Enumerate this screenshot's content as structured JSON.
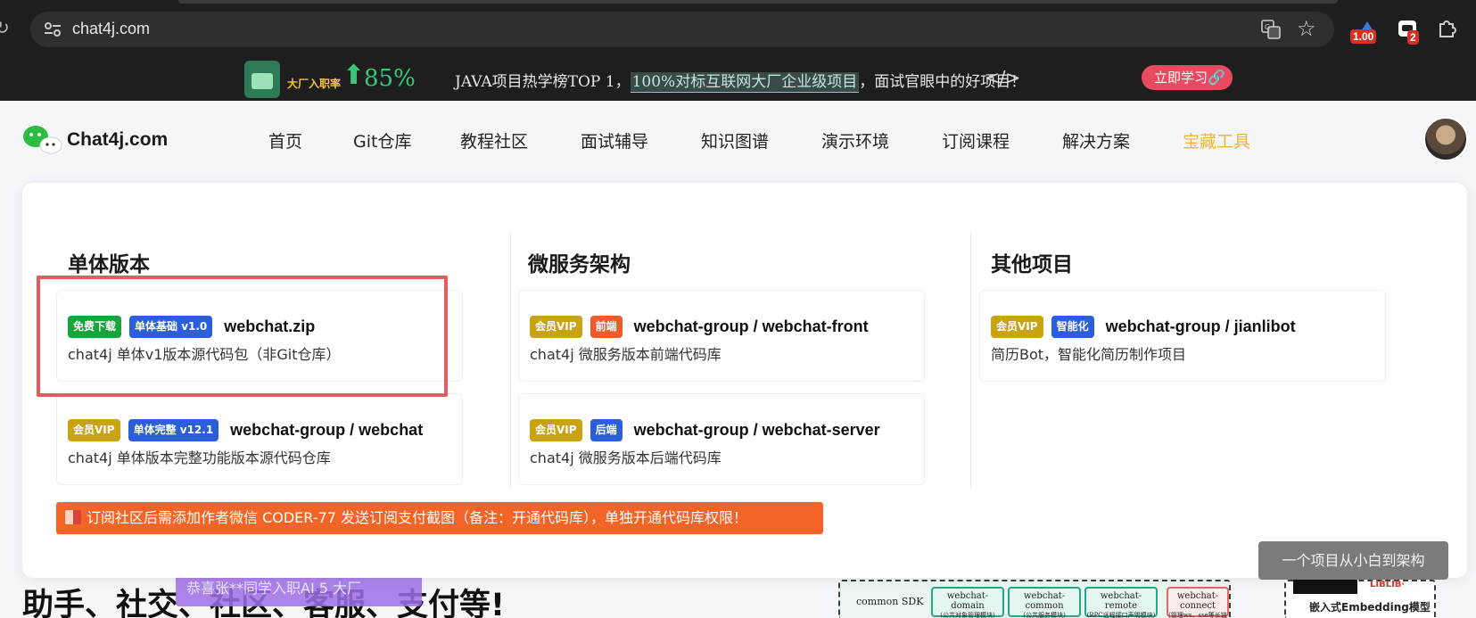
{
  "browser": {
    "url": "chat4j.com",
    "extensions": [
      {
        "icon": "metric-extension-icon",
        "badge": "1.00"
      },
      {
        "icon": "bot-extension-icon",
        "badge": "2"
      },
      {
        "icon": "puzzle-extensions-icon"
      }
    ]
  },
  "promo": {
    "rate_label": "大厂入职率",
    "rate": "85%",
    "text_before": "JAVA项目热学榜TOP 1，",
    "text_highlight": "100%对标互联网大厂企业级项目",
    "text_after": "，面试官眼中的好项目！",
    "cta": "立即学习"
  },
  "nav": {
    "brand": "Chat4j.com",
    "items": [
      "首页",
      "Git仓库",
      "教程社区",
      "面试辅导",
      "知识图谱",
      "演示环境",
      "订阅课程",
      "解决方案",
      "宝藏工具"
    ],
    "active_index": 8
  },
  "panel": {
    "columns": [
      {
        "title": "单体版本",
        "cards": [
          {
            "tags": [
              {
                "label": "免费下载",
                "color": "green"
              },
              {
                "label": "单体基础 v1.0",
                "color": "blue"
              }
            ],
            "title": "webchat.zip",
            "desc": "chat4j 单体v1版本源代码包（非Git仓库）"
          },
          {
            "tags": [
              {
                "label": "会员VIP",
                "color": "gold"
              },
              {
                "label": "单体完整 v12.1",
                "color": "blue"
              }
            ],
            "title": "webchat-group / webchat",
            "desc": "chat4j 单体版本完整功能版本源代码仓库"
          }
        ]
      },
      {
        "title": "微服务架构",
        "cards": [
          {
            "tags": [
              {
                "label": "会员VIP",
                "color": "gold"
              },
              {
                "label": "前端",
                "color": "orange"
              }
            ],
            "title": "webchat-group / webchat-front",
            "desc": "chat4j 微服务版本前端代码库"
          },
          {
            "tags": [
              {
                "label": "会员VIP",
                "color": "gold"
              },
              {
                "label": "后端",
                "color": "blue"
              }
            ],
            "title": "webchat-group / webchat-server",
            "desc": "chat4j 微服务版本后端代码库"
          }
        ]
      },
      {
        "title": "其他项目",
        "cards": [
          {
            "tags": [
              {
                "label": "会员VIP",
                "color": "gold"
              },
              {
                "label": "智能化",
                "color": "blue"
              }
            ],
            "title": "webchat-group / jianlibot",
            "desc": "简历Bot，智能化简历制作项目"
          }
        ]
      }
    ],
    "notice": "订阅社区后需添加作者微信 CODER-77 发送订阅支付截图（备注：开通代码库），单独开通代码库权限！",
    "tooltip": "一个项目从小白到架构"
  },
  "background": {
    "headline": "助手、社交、社区、客服、支付等!",
    "toast": "恭喜张**同学入职AI 5 大厂",
    "diagram_label": "common SDK",
    "modules": [
      {
        "name": "webchat-domain",
        "sub": "(公共对象管理模块)"
      },
      {
        "name": "webchat-common",
        "sub": "(公共服务模块)"
      },
      {
        "name": "webchat-remote",
        "sub": "(RPC远程接口声明模块)"
      },
      {
        "name": "webchat-connect",
        "sub": "(管理ws、sse等长链接服务)"
      }
    ],
    "embed_label": "嵌入式Embedding模型",
    "embed_tag": "LIBLIB·"
  },
  "colors": {
    "accent_active_nav": "#f0b43a",
    "highlight_box": "#e85b5b",
    "notice_bar": "#f56427",
    "tag_green": "#17a43b",
    "tag_blue": "#2b5fd9",
    "tag_gold": "#c9a313",
    "tag_orange": "#f05a28"
  }
}
